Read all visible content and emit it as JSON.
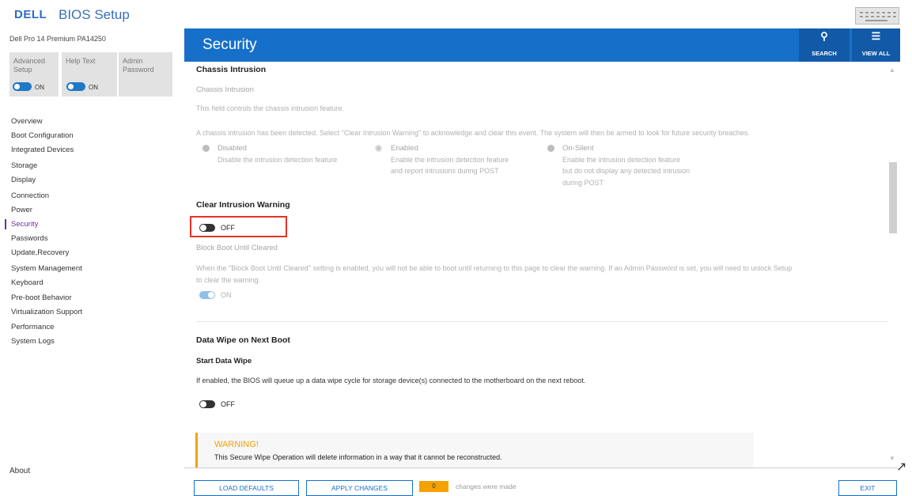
{
  "header": {
    "brand": "DELL",
    "title": "BIOS Setup"
  },
  "sidebar": {
    "model": "Dell Pro 14 Premium PA14250",
    "advanced_setup": {
      "label1": "Advanced",
      "label2": "Setup",
      "state": "ON"
    },
    "help_text": {
      "label": "Help Text",
      "state": "ON"
    },
    "admin_password": {
      "label1": "Admin",
      "label2": "Password"
    },
    "items": [
      "Overview",
      "Boot Configuration",
      "Integrated Devices",
      "Storage",
      "Display",
      "Connection",
      "Power",
      "Security",
      "Passwords",
      "Update,Recovery",
      "System Management",
      "Keyboard",
      "Pre-boot Behavior",
      "Virtualization Support",
      "Performance",
      "System Logs"
    ],
    "active_item": "Security",
    "about": "About"
  },
  "topbar": {
    "title": "Security",
    "search_label": "SEARCH",
    "view_all_label": "VIEW ALL"
  },
  "chassis": {
    "section_title": "Chassis Intrusion",
    "setting_name": "Chassis Intrusion",
    "description": "This field controls the chassis intrusion feature.",
    "detected_msg": "A chassis intrusion has been detected.  Select \"Clear Intrusion Warning\" to acknowledge and clear this event.  The system will then be armed to look for future security breaches.",
    "options": [
      {
        "label": "Disabled",
        "desc1": "Disable the intrusion detection feature",
        "desc2": "",
        "desc3": "",
        "selected": false
      },
      {
        "label": "Enabled",
        "desc1": "Enable the intrusion detection feature",
        "desc2": "and report intrusions during POST",
        "desc3": "",
        "selected": true
      },
      {
        "label": "On-Silent",
        "desc1": "Enable the intrusion detection feature",
        "desc2": "but do not display any detected intrusion",
        "desc3": "during POST",
        "selected": false
      }
    ]
  },
  "clear_warning": {
    "title": "Clear Intrusion Warning",
    "state": "OFF"
  },
  "block_boot": {
    "title": "Block Boot Until Cleared",
    "desc_line1": "When the \"Block Boot Until Cleared\" setting is enabled, you will not be able to boot until returning to this page to clear the warning. If an Admin Password is set, you will need to unlock Setup",
    "desc_line2": "to clear the warning.",
    "state": "ON"
  },
  "data_wipe": {
    "section_title": "Data Wipe on Next Boot",
    "setting_name": "Start Data Wipe",
    "description": "If enabled, the BIOS will queue up a data wipe cycle for storage device(s) connected to the motherboard on the next reboot.",
    "state": "OFF"
  },
  "warning": {
    "title": "WARNING!",
    "text": "This Secure Wipe Operation will delete information in a way that it cannot be reconstructed."
  },
  "footer": {
    "load_defaults": "LOAD DEFAULTS",
    "apply_changes": "APPLY CHANGES",
    "change_count": "0",
    "changes_text": "changes were made",
    "exit": "EXIT"
  },
  "colors": {
    "accent": "#1670c9",
    "accent_dark": "#125aa7",
    "warning": "#f5a200",
    "highlight": "#e53226",
    "active_nav": "#6a2ea0"
  },
  "icons": [
    "keyboard-icon",
    "search-icon",
    "view-all-icon",
    "chevron-up-icon",
    "chevron-down-icon",
    "mouse-cursor-icon"
  ]
}
